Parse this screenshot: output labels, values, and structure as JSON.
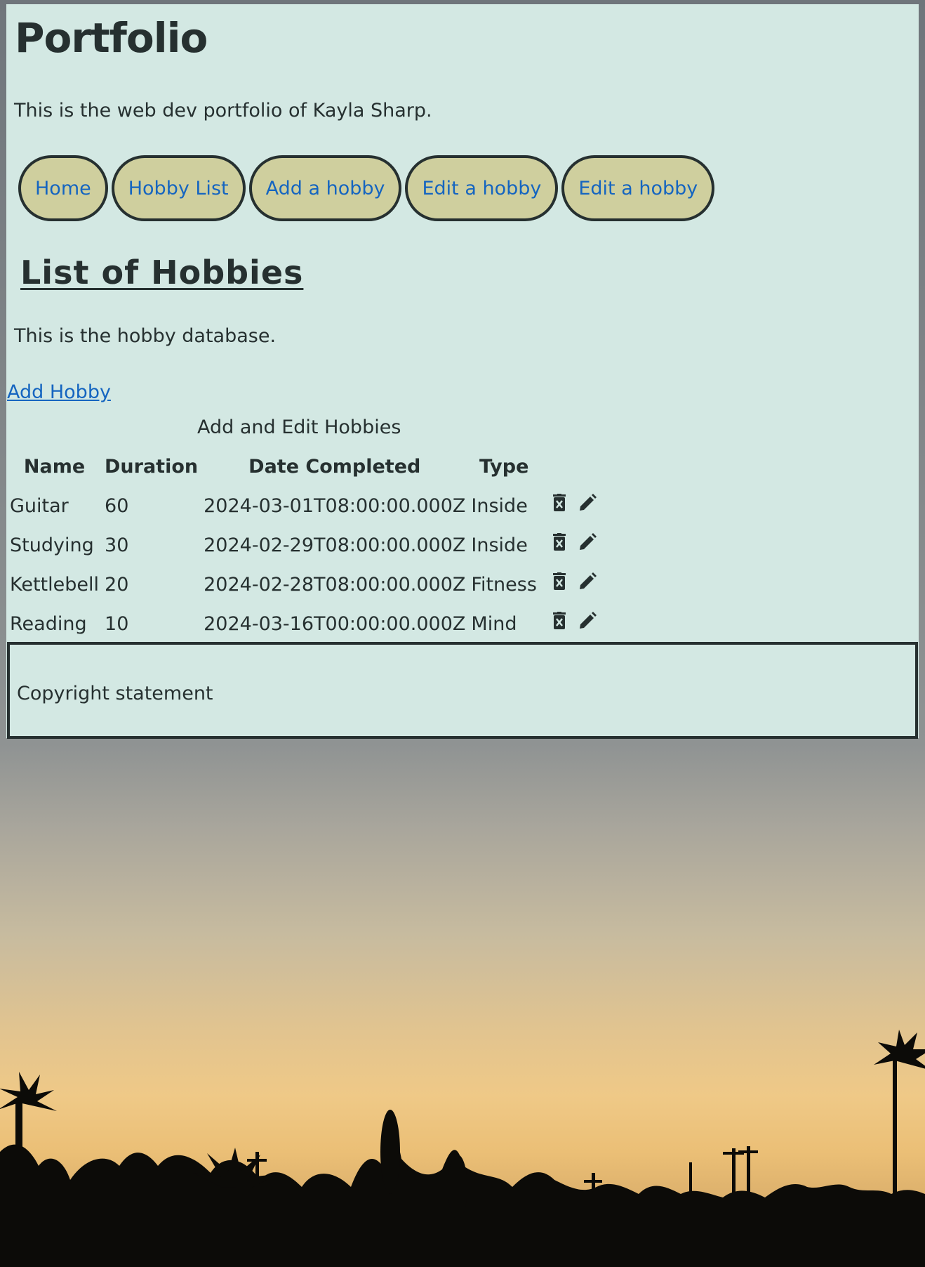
{
  "header": {
    "title": "Portfolio",
    "intro": "This is the web dev portfolio of Kayla Sharp."
  },
  "nav": {
    "items": [
      {
        "label": "Home"
      },
      {
        "label": "Hobby List"
      },
      {
        "label": "Add a hobby"
      },
      {
        "label": "Edit a hobby"
      },
      {
        "label": "Edit a hobby"
      }
    ]
  },
  "main": {
    "title": "List of Hobbies",
    "description": "This is the hobby database.",
    "add_link": "Add Hobby",
    "table": {
      "caption": "Add and Edit Hobbies",
      "columns": [
        "Name",
        "Duration",
        "Date Completed",
        "Type"
      ],
      "rows": [
        {
          "name": "Guitar",
          "duration": "60",
          "date": "2024-03-01T08:00:00.000Z",
          "type": "Inside"
        },
        {
          "name": "Studying",
          "duration": "30",
          "date": "2024-02-29T08:00:00.000Z",
          "type": "Inside"
        },
        {
          "name": "Kettlebell",
          "duration": "20",
          "date": "2024-02-28T08:00:00.000Z",
          "type": "Fitness"
        },
        {
          "name": "Reading",
          "duration": "10",
          "date": "2024-03-16T00:00:00.000Z",
          "type": "Mind"
        }
      ],
      "row_actions": {
        "delete_icon": "trash-icon",
        "edit_icon": "pencil-icon"
      }
    }
  },
  "footer": {
    "text": "Copyright statement"
  },
  "colors": {
    "panel_bg": "#d3e8e3",
    "button_bg": "#cfcf9e",
    "link": "#1565c0",
    "text": "#263030"
  }
}
